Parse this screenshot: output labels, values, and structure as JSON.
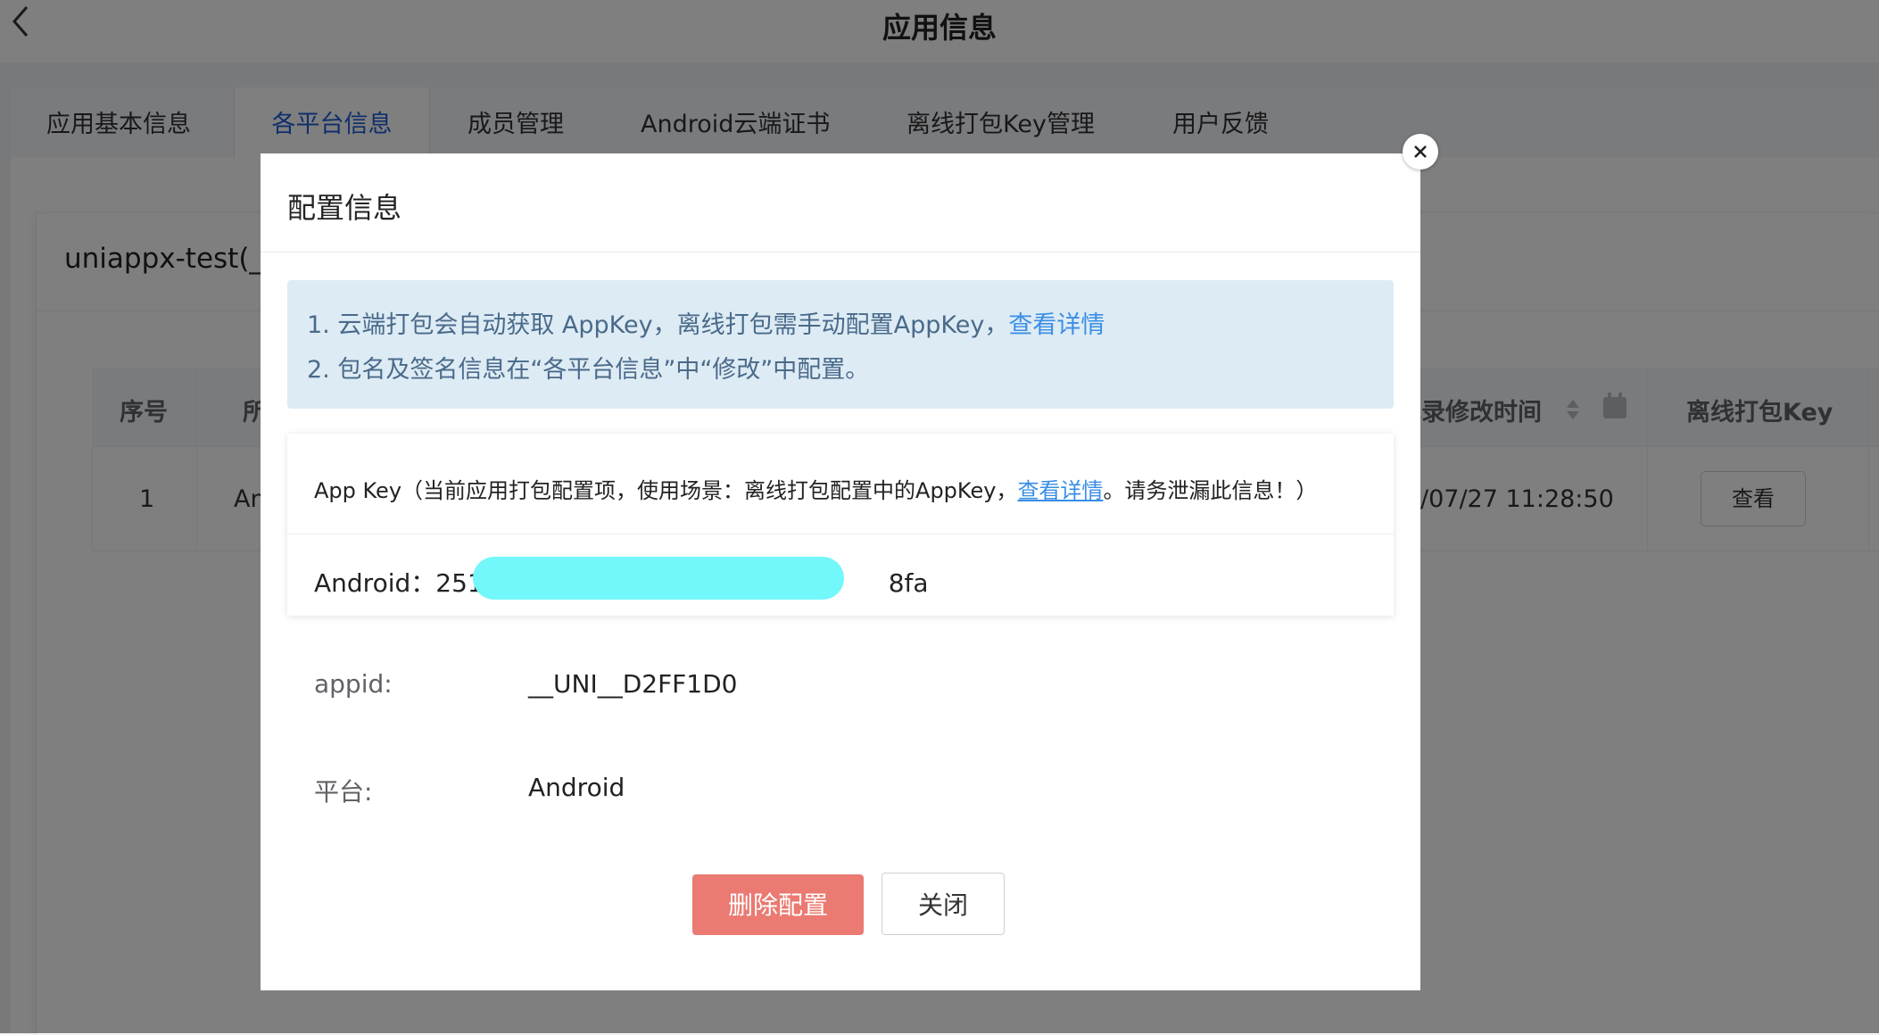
{
  "header": {
    "title": "应用信息",
    "back_icon": "chevron-left-icon"
  },
  "tabs": [
    {
      "label": "应用基本信息",
      "active": false
    },
    {
      "label": "各平台信息",
      "active": true
    },
    {
      "label": "成员管理",
      "active": false
    },
    {
      "label": "Android云端证书",
      "active": false
    },
    {
      "label": "离线打包Key管理",
      "active": false
    },
    {
      "label": "用户反馈",
      "active": false
    }
  ],
  "card": {
    "title_visible": "uniappx-test(_",
    "table": {
      "headers_visible": [
        "序号",
        "所",
        "记录修改时间",
        "离线打包Key"
      ],
      "row": {
        "index": "1",
        "col2_visible": "An",
        "time_visible": "/07/27 11:28:50",
        "action_label": "查看"
      }
    }
  },
  "modal": {
    "title": "配置信息",
    "notice": {
      "line1_text": "1. 云端打包会自动获取 AppKey，离线打包需手动配置AppKey，",
      "line1_link": "查看详情",
      "line2_text": "2. 包名及签名信息在“各平台信息”中“修改”中配置。"
    },
    "appkey": {
      "head_prefix": "App Key（当前应用打包配置项，使用场景：离线打包配置中的AppKey，",
      "head_link": "查看详情",
      "head_suffix": "。请务泄漏此信息！）",
      "android_label": "Android：",
      "android_value_start": "251",
      "android_value_end": "8fa"
    },
    "fields": [
      {
        "label": "appid:",
        "value": "__UNI__D2FF1D0"
      },
      {
        "label": "平台:",
        "value": "Android"
      }
    ],
    "buttons": {
      "delete_label": "删除配置",
      "close_label": "关闭"
    },
    "colors": {
      "danger": "#ea7a72",
      "link": "#3a8ee6",
      "notice_bg": "#ddebf4",
      "redaction": "#72f7fb"
    }
  }
}
